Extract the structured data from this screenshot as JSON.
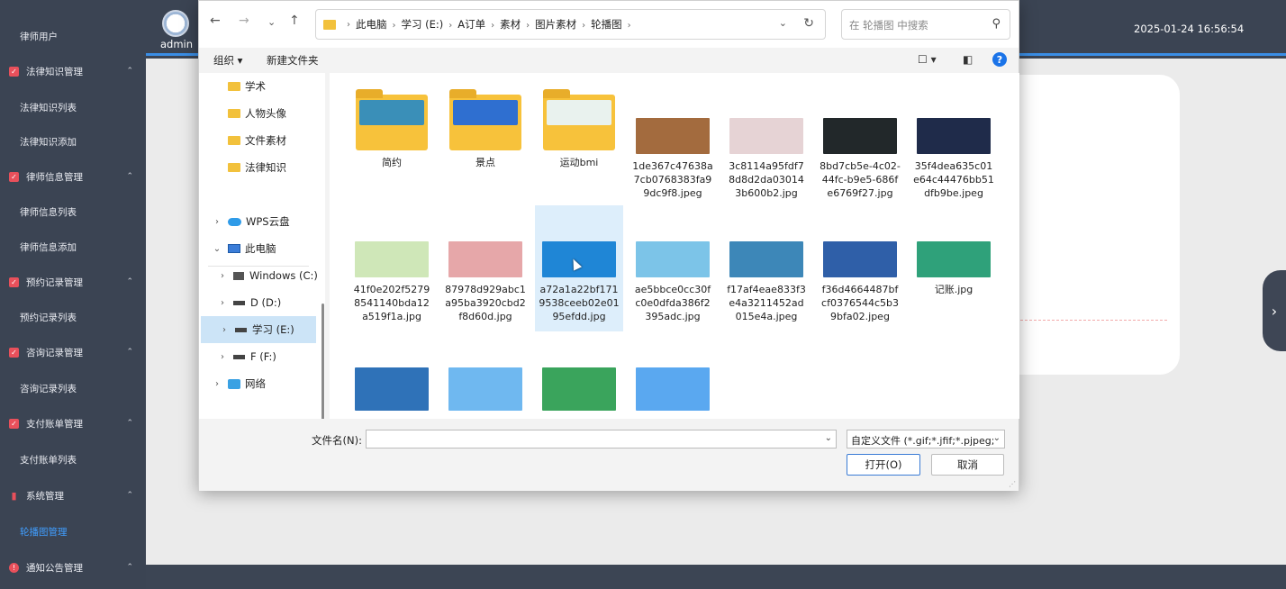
{
  "header": {
    "admin": "admin",
    "datetime": "2025-01-24 16:56:54"
  },
  "sidebar": {
    "items": [
      {
        "label": "律师用户",
        "kind": "sub"
      },
      {
        "label": "法律知识管理",
        "kind": "group",
        "icon": "checkbox-icon"
      },
      {
        "label": "法律知识列表",
        "kind": "sub"
      },
      {
        "label": "法律知识添加",
        "kind": "sub"
      },
      {
        "label": "律师信息管理",
        "kind": "group",
        "icon": "checkbox-icon"
      },
      {
        "label": "律师信息列表",
        "kind": "sub"
      },
      {
        "label": "律师信息添加",
        "kind": "sub"
      },
      {
        "label": "预约记录管理",
        "kind": "group",
        "icon": "checkbox-icon"
      },
      {
        "label": "预约记录列表",
        "kind": "sub"
      },
      {
        "label": "咨询记录管理",
        "kind": "group",
        "icon": "checkbox-icon"
      },
      {
        "label": "咨询记录列表",
        "kind": "sub"
      },
      {
        "label": "支付账单管理",
        "kind": "group",
        "icon": "checkbox-icon"
      },
      {
        "label": "支付账单列表",
        "kind": "sub"
      },
      {
        "label": "系统管理",
        "kind": "group",
        "icon": "bar-chart-icon"
      },
      {
        "label": "轮播图管理",
        "kind": "sub",
        "active": true
      },
      {
        "label": "通知公告管理",
        "kind": "group",
        "icon": "alert-circle-icon"
      }
    ]
  },
  "dialog": {
    "breadcrumb": [
      "此电脑",
      "学习 (E:)",
      "A订单",
      "素材",
      "图片素材",
      "轮播图"
    ],
    "search_placeholder": "在 轮播图 中搜索",
    "toolbar": {
      "organize": "组织 ▾",
      "new_folder": "新建文件夹"
    },
    "nav": [
      {
        "label": "学术",
        "type": "folder"
      },
      {
        "label": "人物头像",
        "type": "folder"
      },
      {
        "label": "文件素材",
        "type": "folder"
      },
      {
        "label": "法律知识",
        "type": "folder"
      },
      {
        "label": "WPS云盘",
        "type": "cloud"
      },
      {
        "label": "此电脑",
        "type": "pc"
      },
      {
        "label": "Windows (C:)",
        "type": "win"
      },
      {
        "label": "D (D:)",
        "type": "drive"
      },
      {
        "label": "学习 (E:)",
        "type": "drive",
        "selected": true
      },
      {
        "label": "F (F:)",
        "type": "drive"
      },
      {
        "label": "网络",
        "type": "net"
      }
    ],
    "files": [
      {
        "name": "简约",
        "type": "folder",
        "color": "#3a8fb8"
      },
      {
        "name": "景点",
        "type": "folder",
        "color": "#2f6fd0"
      },
      {
        "name": "运动bmi",
        "type": "folder",
        "color": "#e9f2ee"
      },
      {
        "name": "1de367c47638a7cb0768383fa99dc9f8.jpeg",
        "type": "image",
        "color": "#a36b3e"
      },
      {
        "name": "3c8114a95fdf78d8d2da030143b600b2.jpg",
        "type": "image",
        "color": "#e6d3d5"
      },
      {
        "name": "8bd7cb5e-4c02-44fc-b9e5-686fe6769f27.jpg",
        "type": "image",
        "color": "#22282a"
      },
      {
        "name": "35f4dea635c01e64c44476bb51dfb9be.jpeg",
        "type": "image",
        "color": "#1f2b4a"
      },
      {
        "name": "41f0e202f52798541140bda12a519f1a.jpg",
        "type": "image",
        "color": "#cfe7b8"
      },
      {
        "name": "87978d929abc1a95ba3920cbd2f8d60d.jpg",
        "type": "image",
        "color": "#e6a7a9"
      },
      {
        "name": "a72a1a22bf1719538ceeb02e0195efdd.jpg",
        "type": "image",
        "color": "#1f86d6",
        "selected": true
      },
      {
        "name": "ae5bbce0cc30fc0e0dfda386f2395adc.jpg",
        "type": "image",
        "color": "#7cc4e8"
      },
      {
        "name": "f17af4eae833f3e4a3211452ad015e4a.jpeg",
        "type": "image",
        "color": "#3d87b8"
      },
      {
        "name": "f36d4664487bfcf0376544c5b39bfa02.jpeg",
        "type": "image",
        "color": "#2f5fa8"
      },
      {
        "name": "记账.jpg",
        "type": "image",
        "color": "#2fa17a"
      },
      {
        "name": "",
        "type": "image",
        "color": "#2f72b8"
      },
      {
        "name": "",
        "type": "image",
        "color": "#6fb8f0"
      },
      {
        "name": "",
        "type": "image",
        "color": "#3aa45c"
      },
      {
        "name": "",
        "type": "image",
        "color": "#5aa8f0"
      }
    ],
    "filename_label": "文件名(N):",
    "filename_value": "",
    "filter": "自定义文件 (*.gif;*.jfif;*.pjpeg;",
    "open": "打开(O)",
    "cancel": "取消"
  }
}
